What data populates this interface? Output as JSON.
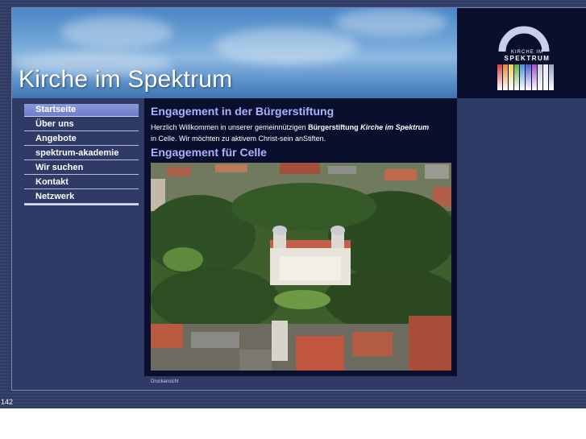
{
  "header": {
    "site_title": "Kirche im Spektrum"
  },
  "logo": {
    "line1": "KIRCHE IM",
    "line2": "SPEKTRUM",
    "bar_colors": [
      "#d94040",
      "#e08a3a",
      "#e8d04a",
      "#5fb04a",
      "#3a9ad9",
      "#5a5ad0",
      "#a050c8",
      "#c8c8d8",
      "#e8e8f0",
      "#9aa0c0"
    ]
  },
  "nav": {
    "items": [
      {
        "label": "Startseite",
        "active": true
      },
      {
        "label": "Über uns"
      },
      {
        "label": "Angebote"
      },
      {
        "label": "spektrum-akademie"
      },
      {
        "label": "Wir suchen"
      },
      {
        "label": "Kontakt"
      },
      {
        "label": "Netzwerk"
      }
    ]
  },
  "main": {
    "heading1": "Engagement in der Bürgerstiftung",
    "intro_pre": "Herzlich Willkommen in unserer gemeinnützigen ",
    "intro_bold": "Bürgerstiftung ",
    "intro_bold_italic": "Kirche im Spektrum",
    "intro_post": "in Celle. Wir möchten zu aktivem Christ-sein anStiften.",
    "heading2": "Engagement für Celle",
    "photo_caption": "Aerial view of Celle castle surrounded by trees and town"
  },
  "footer": {
    "print_link": "Druckansicht",
    "counter": "142"
  }
}
